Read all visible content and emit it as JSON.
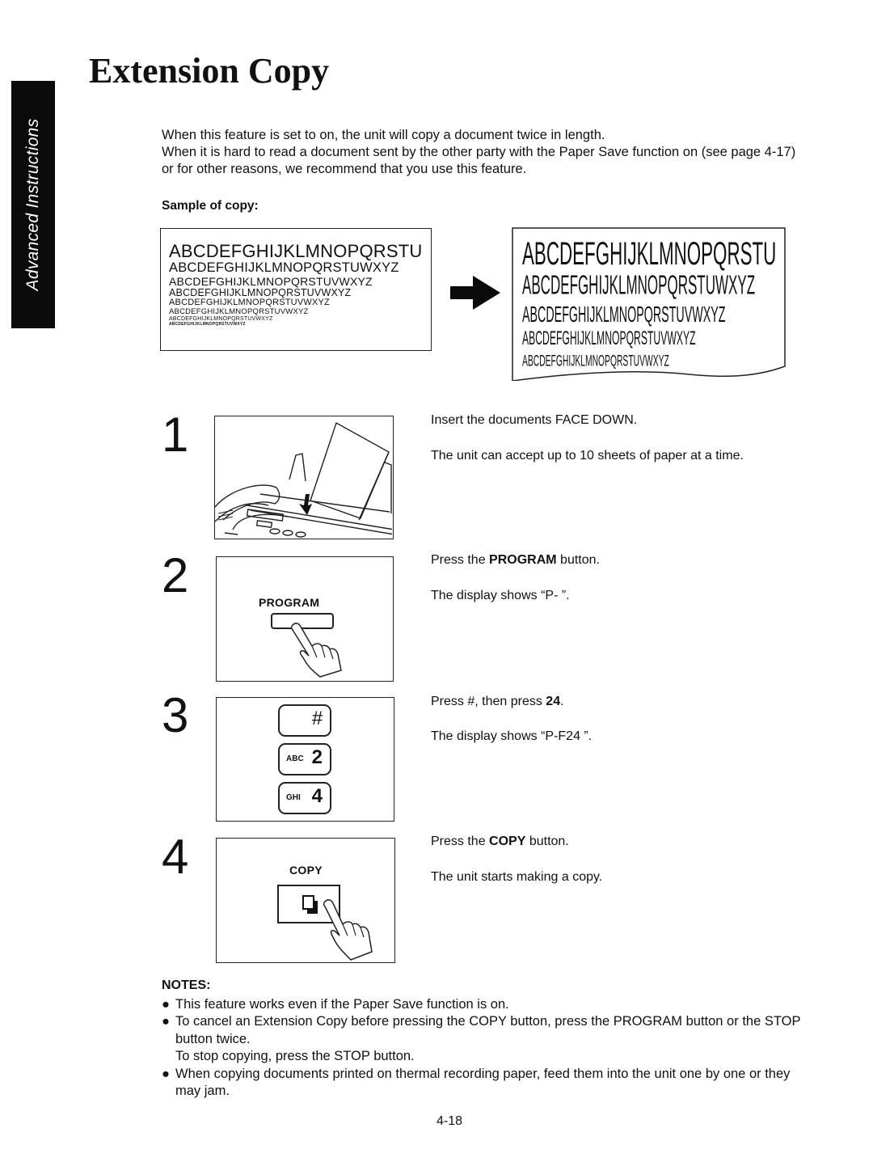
{
  "side_tab": {
    "label": "Advanced Instructions"
  },
  "title": "Extension Copy",
  "intro": [
    "When this feature is set to on, the unit will copy a document twice in length.",
    "When it is hard to read a document sent by the other party with the Paper Save function on (see page 4-17) or for other reasons, we recommend that you use this feature."
  ],
  "sample": {
    "label": "Sample of copy:",
    "original_lines": [
      "ABCDEFGHIJKLMNOPQRSTU",
      "ABCDEFGHIJKLMNOPQRSTUWXYZ",
      "ABCDEFGHIJKLMNOPQRSTUVWXYZ",
      "ABCDEFGHIJKLMNOPQRSTUVWXYZ",
      "ABCDEFGHIJKLMNOPQRSTUVWXYZ",
      "ABCDEFGHIJKLMNOPQRSTUVWXYZ",
      "ABCDEFGHIJKLMNOPQRSTUVWXYZ",
      "ABCDEFGHIJKLMNOPQRSTUVWXYZ"
    ],
    "extended_lines": [
      "ABCDEFGHIJKLMNOPQRSTU",
      "ABCDEFGHIJKLMNOPQRSTUWXYZ",
      "ABCDEFGHIJKLMNOPQRSTUVWXYZ",
      "ABCDEFGHIJKLMNOPQRSTUVWXYZ",
      "ABCDEFGHIJKLMNOPQRSTUVWXYZ"
    ],
    "arrow_icon": "right-arrow-icon"
  },
  "steps": [
    {
      "number": "1",
      "illustration": "fax-document-feed",
      "lines": [
        "Insert the documents FACE DOWN.",
        "The unit can accept up to 10 sheets of paper at a time."
      ]
    },
    {
      "number": "2",
      "button_label": "PROGRAM",
      "line1_pre": "Press the ",
      "line1_bold": "PROGRAM",
      "line1_post": " button.",
      "line2": "The display shows “P-  ”."
    },
    {
      "number": "3",
      "keys": [
        {
          "small": "",
          "big": "#"
        },
        {
          "small": "ABC",
          "big": "2"
        },
        {
          "small": "GHI",
          "big": "4"
        }
      ],
      "line1_pre": "Press #, then press ",
      "line1_bold": "24",
      "line1_post": ".",
      "line2": "The display shows “P-F24  ”."
    },
    {
      "number": "4",
      "button_label": "COPY",
      "line1_pre": "Press the ",
      "line1_bold": "COPY",
      "line1_post": " button.",
      "line2": "The unit starts making a copy."
    }
  ],
  "notes": {
    "heading": "NOTES:",
    "bullet": "●",
    "items": [
      {
        "lines": [
          "This feature works even if the Paper Save function is on."
        ]
      },
      {
        "lines": [
          "To cancel an Extension Copy before pressing the COPY button, press the PROGRAM button or the STOP button twice.",
          "To stop copying, press the STOP button."
        ]
      },
      {
        "lines": [
          "When copying documents printed on thermal recording paper, feed them into the unit one by one or they may jam."
        ]
      }
    ]
  },
  "page_number": "4-18"
}
